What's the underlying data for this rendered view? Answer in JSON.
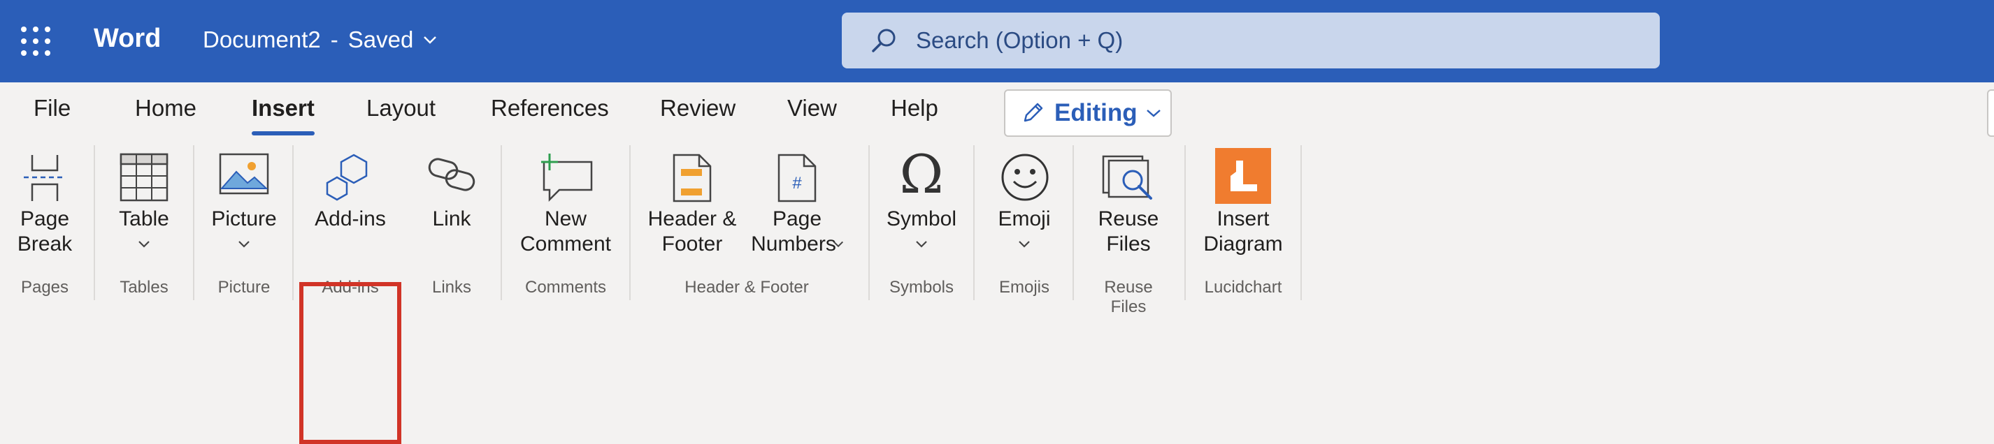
{
  "app": {
    "name": "Word"
  },
  "document": {
    "title": "Document2",
    "separator": "-",
    "status": "Saved"
  },
  "search": {
    "placeholder": "Search (Option + Q)"
  },
  "tabs": [
    {
      "label": "File"
    },
    {
      "label": "Home"
    },
    {
      "label": "Insert",
      "active": true
    },
    {
      "label": "Layout"
    },
    {
      "label": "References"
    },
    {
      "label": "Review"
    },
    {
      "label": "View"
    },
    {
      "label": "Help"
    }
  ],
  "mode": {
    "label": "Editing"
  },
  "ribbon": {
    "commands": {
      "page_break": {
        "line1": "Page",
        "line2": "Break"
      },
      "table": {
        "label": "Table"
      },
      "picture": {
        "label": "Picture"
      },
      "add_ins": {
        "label": "Add-ins"
      },
      "link": {
        "label": "Link"
      },
      "new_comment": {
        "line1": "New",
        "line2": "Comment"
      },
      "header_footer": {
        "line1": "Header &",
        "line2": "Footer"
      },
      "page_numbers": {
        "line1": "Page",
        "line2": "Numbers"
      },
      "symbol": {
        "label": "Symbol"
      },
      "emoji": {
        "label": "Emoji"
      },
      "reuse_files": {
        "line1": "Reuse",
        "line2": "Files"
      },
      "insert_diagram": {
        "line1": "Insert",
        "line2": "Diagram"
      }
    },
    "groups": {
      "pages": "Pages",
      "tables": "Tables",
      "picture": "Picture",
      "add_ins": "Add-ins",
      "links": "Links",
      "comments": "Comments",
      "header_footer": "Header & Footer",
      "symbols": "Symbols",
      "emojis": "Emojis",
      "reuse_files": "Reuse Files",
      "lucidchart": "Lucidchart"
    }
  },
  "colors": {
    "brand": "#2b5eb8",
    "highlight": "#d13427",
    "lucid": "#f07c2f"
  },
  "icons": {
    "app_launcher": "waffle-icon",
    "search": "search-icon",
    "editing": "pencil-icon",
    "symbol": "omega-icon",
    "emoji": "smiley-icon"
  }
}
